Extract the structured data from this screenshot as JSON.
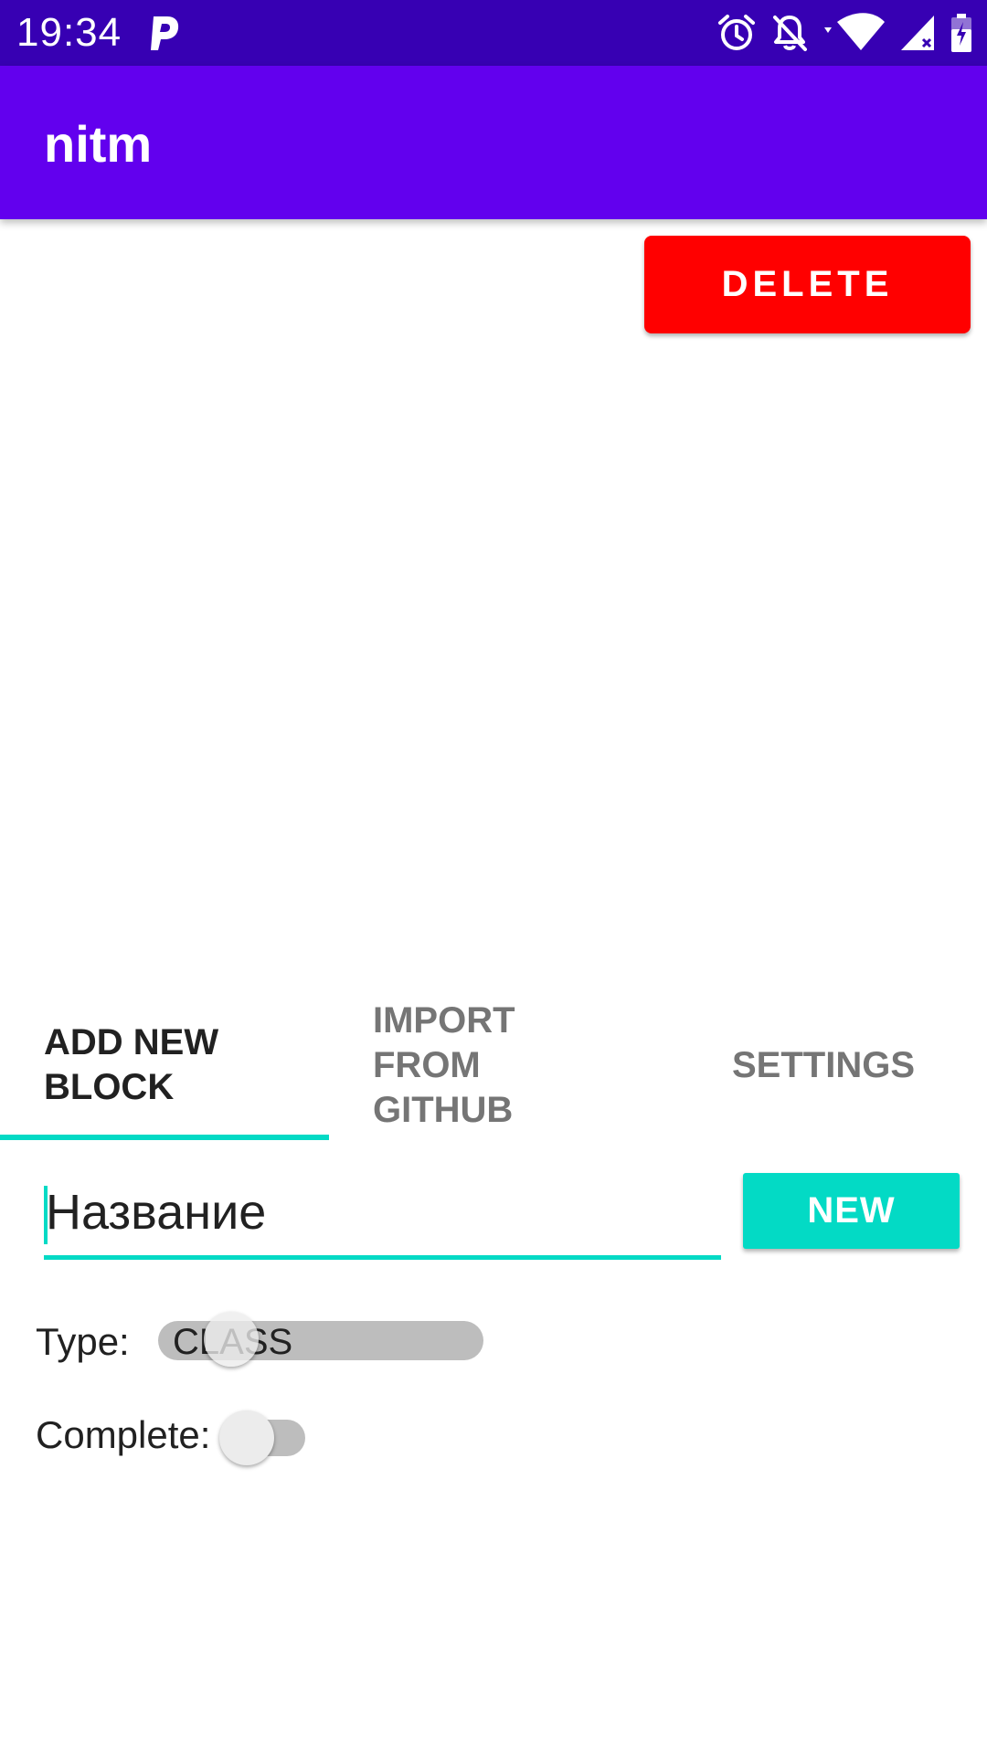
{
  "status_bar": {
    "time": "19:34",
    "icons": [
      "parking-p-icon",
      "alarm-icon",
      "notifications-off-icon",
      "wifi-icon",
      "signal-icon",
      "battery-charging-icon"
    ],
    "background_color": "#3700B3"
  },
  "app_bar": {
    "title": "nitm",
    "background_color": "#6200EE"
  },
  "delete_button": {
    "label": "DELETE",
    "color": "#FF0000"
  },
  "tabs": [
    {
      "label": "ADD NEW BLOCK",
      "selected": true
    },
    {
      "label": "IMPORT FROM GITHUB",
      "selected": false
    },
    {
      "label": "SETTINGS",
      "selected": false
    }
  ],
  "accent_color": "#03DAC5",
  "form": {
    "name_value": "Название",
    "new_button_label": "NEW",
    "type_label": "Type:",
    "type_switch_text": "CLASS",
    "complete_label": "Complete:",
    "complete_checked": false
  }
}
